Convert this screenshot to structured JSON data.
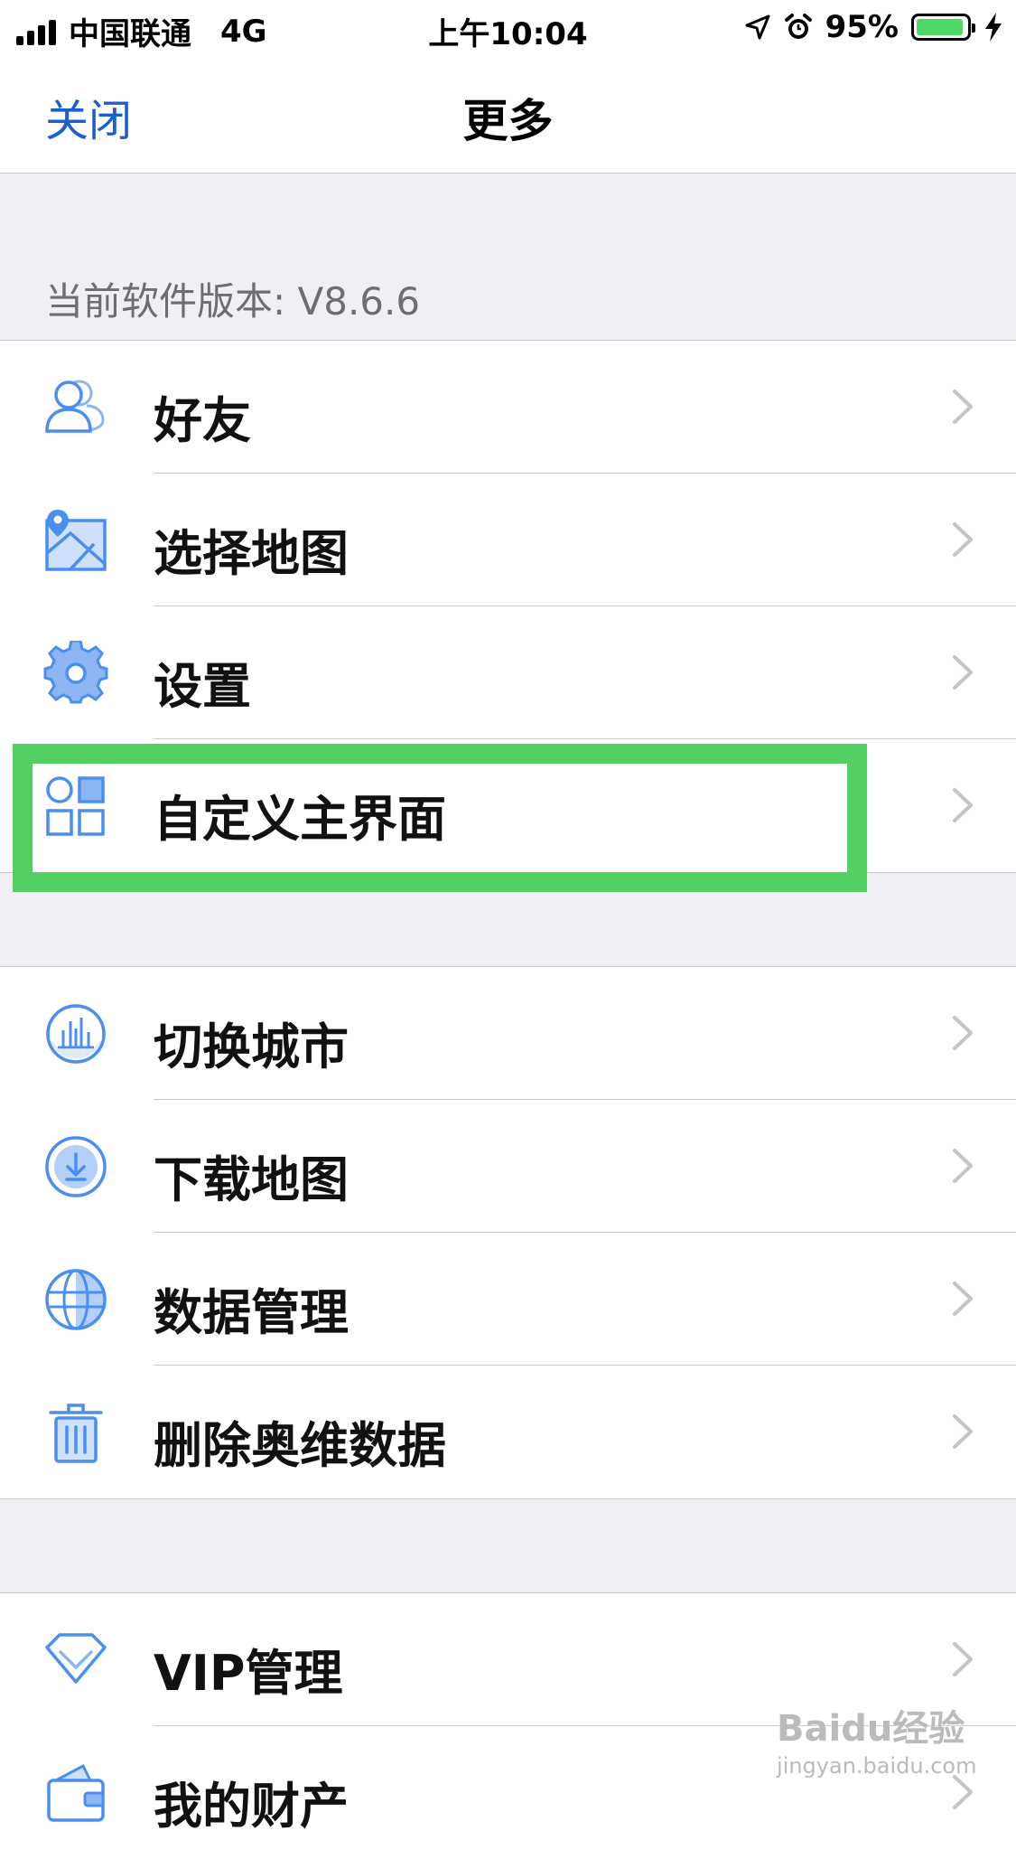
{
  "status_bar": {
    "carrier": "中国联通",
    "network": "4G",
    "time": "上午10:04",
    "battery_percent": "95%",
    "battery_level": 0.95
  },
  "nav": {
    "close_label": "关闭",
    "title": "更多"
  },
  "version_label": "当前软件版本: V8.6.6",
  "groups": [
    {
      "items": [
        {
          "label": "好友",
          "icon": "friends-icon"
        },
        {
          "label": "选择地图",
          "icon": "map-icon"
        },
        {
          "label": "设置",
          "icon": "gear-icon"
        },
        {
          "label": "自定义主界面",
          "icon": "grid-icon"
        }
      ]
    },
    {
      "items": [
        {
          "label": "切换城市",
          "icon": "city-icon"
        },
        {
          "label": "下载地图",
          "icon": "download-icon"
        },
        {
          "label": "数据管理",
          "icon": "globe-icon"
        },
        {
          "label": "删除奥维数据",
          "icon": "trash-icon"
        }
      ]
    },
    {
      "items": [
        {
          "label": "VIP管理",
          "icon": "diamond-icon"
        },
        {
          "label": "我的财产",
          "icon": "wallet-icon"
        }
      ]
    }
  ],
  "watermark": {
    "brand": "Baidu经验",
    "url": "jingyan.baidu.com"
  },
  "colors": {
    "accent": "#1a5fd0",
    "icon_blue": "#4a8ef0",
    "highlight_green": "#52d064",
    "battery_green": "#4cd964"
  }
}
